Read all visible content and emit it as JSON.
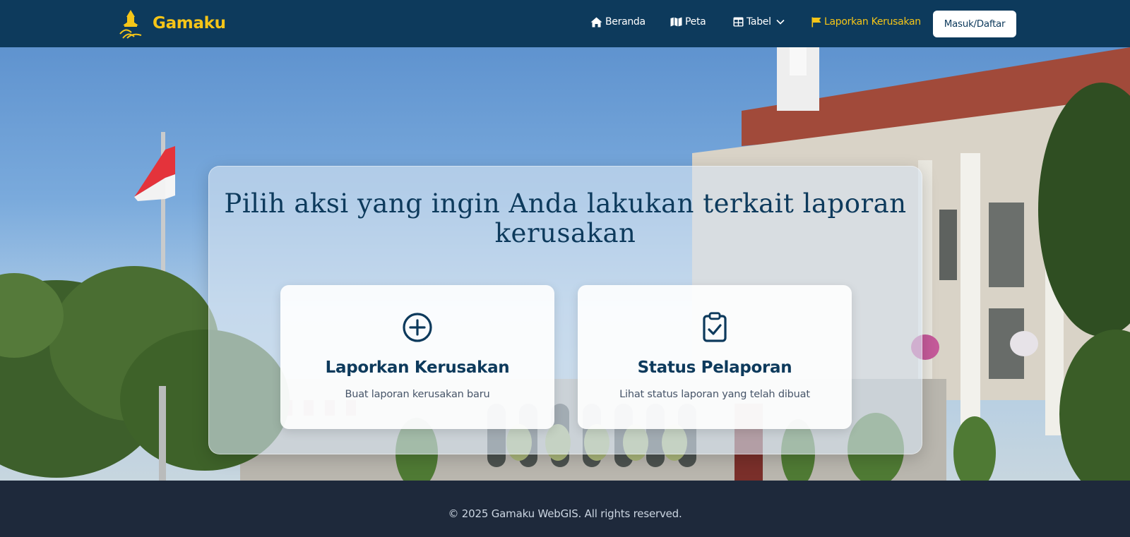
{
  "brand": {
    "name": "Gamaku",
    "logo_icon": "gamaku-logo-icon"
  },
  "nav": {
    "items": [
      {
        "label": "Beranda",
        "icon": "home-icon"
      },
      {
        "label": "Peta",
        "icon": "map-icon"
      },
      {
        "label": "Tabel",
        "icon": "table-icon",
        "dropdown_icon": "chevron-down-icon"
      },
      {
        "label": "Laporkan Kerusakan",
        "icon": "flag-icon"
      }
    ],
    "login_label": "Masuk/Daftar"
  },
  "main": {
    "title": "Pilih aksi yang ingin Anda lakukan terkait laporan kerusakan",
    "cards": [
      {
        "title": "Laporkan Kerusakan",
        "description": "Buat laporan kerusakan baru",
        "icon": "plus-circle-icon"
      },
      {
        "title": "Status Pelaporan",
        "description": "Lihat status laporan yang telah dibuat",
        "icon": "clipboard-check-icon"
      }
    ]
  },
  "footer": {
    "text": "© 2025 Gamaku WebGIS. All rights reserved."
  },
  "colors": {
    "navbar": "#0d3a5c",
    "brand_accent": "#f5c518",
    "primary_text": "#0d3a5c",
    "footer": "#1e293b"
  }
}
